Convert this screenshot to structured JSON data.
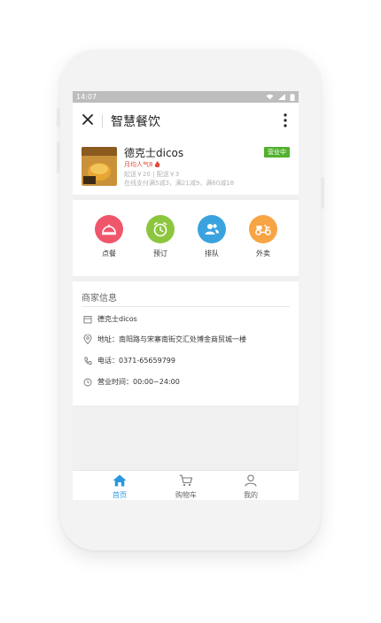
{
  "status": {
    "time": "14:07"
  },
  "appbar": {
    "title": "智慧餐饮"
  },
  "shop": {
    "name": "德克士dicos",
    "popular": "月均人气8",
    "fee": "起送￥20 | 配送￥3",
    "promo": "在线支付满5减3，满21减9，满60减18",
    "badge": "营业中",
    "thumb_text": "乐享饭盒"
  },
  "actions": [
    {
      "label": "点餐",
      "color": "#f0566b",
      "icon": "cloche-icon"
    },
    {
      "label": "预订",
      "color": "#8cc63f",
      "icon": "clock-icon"
    },
    {
      "label": "排队",
      "color": "#3aa3df",
      "icon": "people-icon"
    },
    {
      "label": "外卖",
      "color": "#f7a445",
      "icon": "scooter-icon"
    }
  ],
  "info": {
    "heading": "商家信息",
    "name": "德克士dicos",
    "address": "地址：南阳路与宋寨南街交汇处博金商贸城一楼",
    "phone": "电话：0371-65659799",
    "hours": "营业时间：00:00~24:00"
  },
  "tabs": [
    {
      "label": "首页",
      "active": true,
      "icon": "home-icon"
    },
    {
      "label": "购物车",
      "active": false,
      "icon": "cart-icon"
    },
    {
      "label": "我的",
      "active": false,
      "icon": "user-icon"
    }
  ],
  "colors": {
    "accent": "#2b97e0",
    "badge": "#52b130",
    "popular": "#e14b3c"
  }
}
